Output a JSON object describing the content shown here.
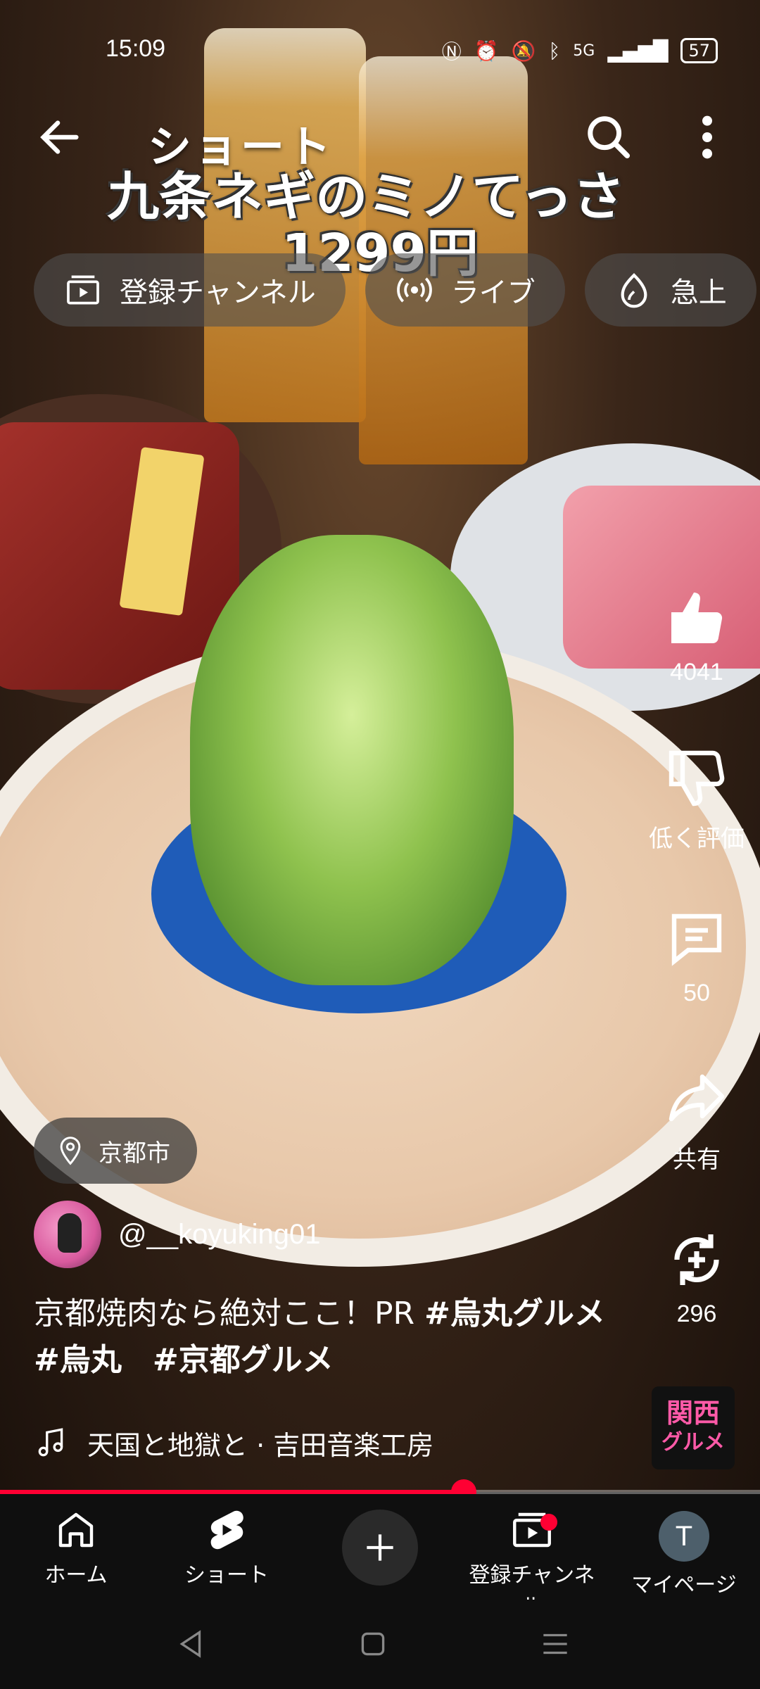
{
  "status_bar": {
    "time": "15:09",
    "network": "5G",
    "battery": "57"
  },
  "header": {
    "title": "ショート"
  },
  "video_overlay": {
    "line1": "九条ネギのミノてっさ",
    "line2": "1299円"
  },
  "chips": [
    {
      "label": "登録チャンネル",
      "icon": "subscriptions-icon"
    },
    {
      "label": "ライブ",
      "icon": "live-icon"
    },
    {
      "label": "急上",
      "icon": "trending-icon"
    }
  ],
  "actions": {
    "like_count": "4041",
    "dislike_label": "低く評価",
    "comment_count": "50",
    "share_label": "共有",
    "remix_count": "296"
  },
  "location": {
    "label": "京都市"
  },
  "channel": {
    "handle": "@__koyuking01"
  },
  "description": {
    "text": "京都焼肉なら絶対ここ！PR ",
    "tags": "#烏丸グルメ#烏丸　#京都グルメ"
  },
  "music": {
    "track": "天国と地獄と · 吉田音楽工房"
  },
  "badge": {
    "line1": "関西",
    "line2": "グルメ"
  },
  "progress": {
    "fraction": 0.61
  },
  "nav": {
    "home": "ホーム",
    "shorts": "ショート",
    "subscriptions": "登録チャンネル",
    "mypage": "マイページ",
    "avatar_letter": "T"
  },
  "colors": {
    "accent": "#ff0033",
    "background": "#0f0f0f"
  }
}
